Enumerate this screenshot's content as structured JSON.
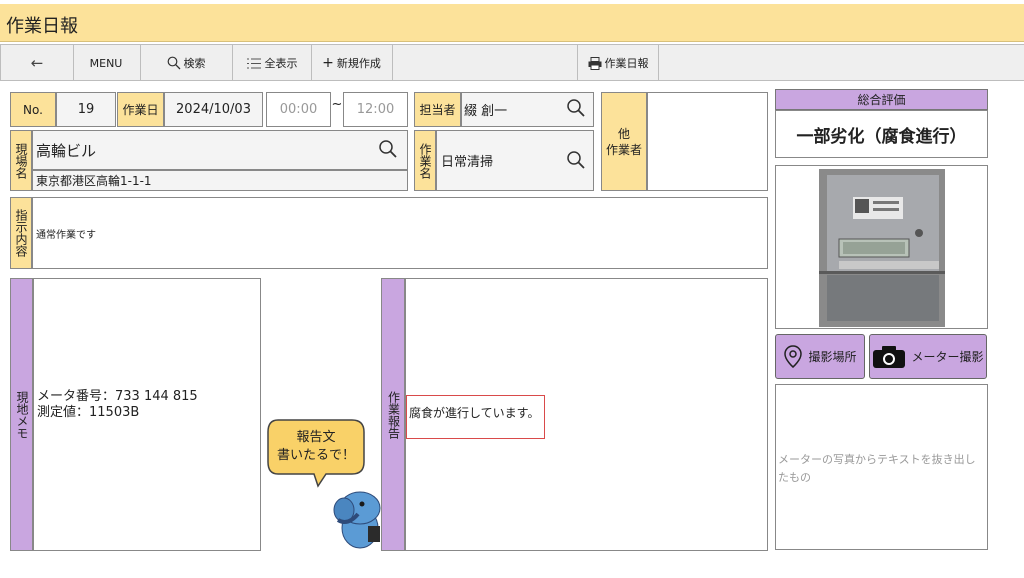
{
  "app": {
    "title": "作業日報"
  },
  "toolbar": {
    "back_label": "←",
    "menu_label": "MENU",
    "search_label": "検索",
    "show_all_label": "全表示",
    "new_label": "新規作成",
    "report_label": "作業日報"
  },
  "form": {
    "no_label": "No.",
    "no_value": "19",
    "date_label": "作業日",
    "date_value": "2024/10/03",
    "start_time": "00:00",
    "time_sep": "~",
    "end_time": "12:00",
    "person_label": "担当者",
    "person_value": "綴 創一",
    "site_label": "現場名",
    "site_name": "高輪ビル",
    "site_address": "東京都港区高輪1-1-1",
    "work_label": "作業名",
    "work_value": "日常清掃",
    "other_label_line1": "他",
    "other_label_line2": "作業者",
    "instruction_label": "指示内容",
    "instruction_value": "通常作業です"
  },
  "memo": {
    "label": "現地メモ",
    "line1": "メータ番号：733 144 815",
    "line2": "測定値：11503B"
  },
  "report": {
    "label": "作業報告",
    "text": "腐食が進行しています。"
  },
  "mascot": {
    "bubble_line1": "報告文",
    "bubble_line2": "書いたるで！"
  },
  "evaluation": {
    "label": "総合評価",
    "value": "一部劣化（腐食進行）"
  },
  "photo_actions": {
    "location_label": "撮影場所",
    "meter_label": "メーター撮影"
  },
  "ocr": {
    "placeholder": "メーターの写真からテキストを抜き出したもの"
  },
  "colors": {
    "yellow": "#fce29a",
    "purple": "#c9a6e0"
  }
}
